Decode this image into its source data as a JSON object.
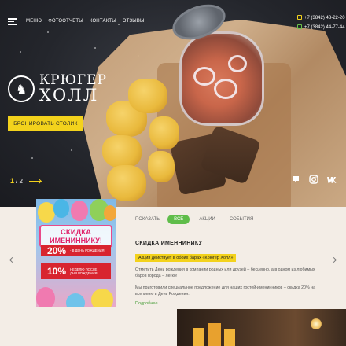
{
  "nav": {
    "items": [
      "МЕНЮ",
      "ФОТООТЧЕТЫ",
      "КОНТАКТЫ",
      "ОТЗЫВЫ"
    ]
  },
  "phones": [
    "+7 (3842) 48-22-20",
    "+7 (3842) 44-77-44"
  ],
  "logo": {
    "line1": "КРЮГЕР",
    "line2": "ХОЛЛ"
  },
  "hero": {
    "book_label": "БРОНИРОВАТЬ СТОЛИК"
  },
  "slider": {
    "current": "1",
    "total": "/ 2"
  },
  "social": [
    "tripadvisor-icon",
    "instagram-icon",
    "vk-icon"
  ],
  "promo": {
    "title_line1": "СКИДКА",
    "title_line2": "ИМЕНИННИКУ!",
    "row1_big": "20%",
    "row1_small": "- В ДЕНЬ РОЖДЕНИЯ",
    "row2_big": "10%",
    "row2_small_1": "НЕДЕЛЮ ПОСЛЕ",
    "row2_small_2": "ДНЯ РОЖДЕНИЯ"
  },
  "filters": {
    "show_label": "ПОКАЗАТЬ",
    "all": "ВСЕ",
    "actions": "АКЦИИ",
    "events": "СОБЫТИЯ"
  },
  "news": {
    "title": "СКИДКА ИМЕННИНИКУ",
    "tag": "Акция действует в обоих барах «Крюгер Холл»",
    "paragraph1": "Отметить День рождения в компании родных или друзей – бесценно, а в одном из любимых баров города – легко!",
    "paragraph2": "Мы приготовили специальное предложение для наших гостей-именинников – скидка 20% на все меню в День Рождения.",
    "more_label": "Подробнее"
  },
  "colors": {
    "accent": "#f3d21c",
    "green": "#5fbd4a",
    "promo_red": "#d8242f"
  }
}
